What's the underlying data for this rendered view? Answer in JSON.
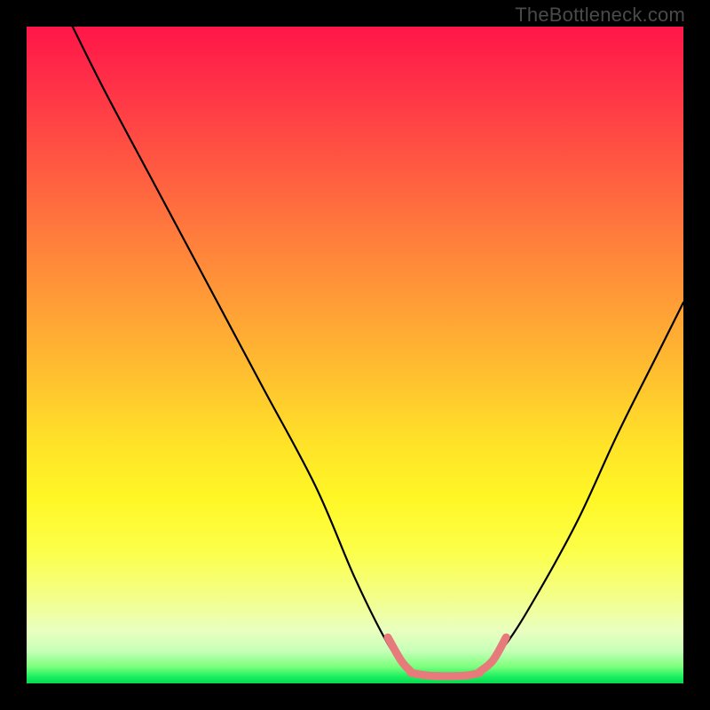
{
  "watermark": "TheBottleneck.com",
  "chart_data": {
    "type": "line",
    "title": "",
    "xlabel": "",
    "ylabel": "",
    "xlim": [
      0,
      100
    ],
    "ylim": [
      0,
      100
    ],
    "grid": false,
    "legend": false,
    "series": [
      {
        "name": "left-curve",
        "x": [
          7,
          12,
          20,
          28,
          36,
          44,
          50,
          55,
          58
        ],
        "values": [
          100,
          90,
          75,
          60,
          45,
          30,
          16,
          6,
          2
        ],
        "color": "#000000"
      },
      {
        "name": "right-curve",
        "x": [
          69,
          73,
          78,
          84,
          90,
          96,
          100
        ],
        "values": [
          2,
          6,
          14,
          25,
          38,
          50,
          58
        ],
        "color": "#000000"
      },
      {
        "name": "left-pink-segment",
        "x": [
          55,
          57,
          58.5
        ],
        "values": [
          7,
          3.5,
          1.8
        ],
        "color": "#e77b7b"
      },
      {
        "name": "floor-pink-segment",
        "x": [
          58.5,
          61,
          64,
          67,
          69
        ],
        "values": [
          1.6,
          1.2,
          1.1,
          1.2,
          1.6
        ],
        "color": "#e77b7b"
      },
      {
        "name": "right-pink-segment",
        "x": [
          69,
          71,
          73
        ],
        "values": [
          1.8,
          3.5,
          7
        ],
        "color": "#e77b7b"
      }
    ],
    "annotations": []
  },
  "colors": {
    "background": "#000000",
    "gradient_top": "#ff1648",
    "gradient_bottom": "#07d850",
    "curve": "#000000",
    "highlight": "#e77b7b",
    "watermark": "#4a4a4a"
  }
}
